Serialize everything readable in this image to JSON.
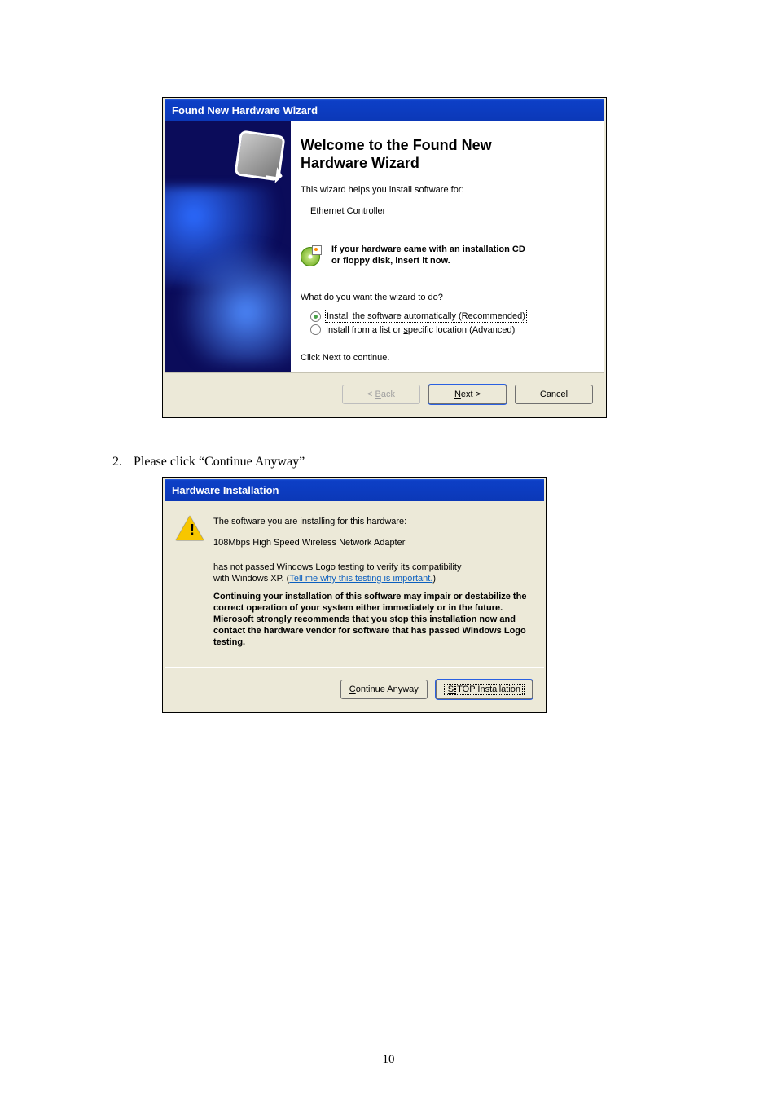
{
  "wizard1": {
    "title": "Found New Hardware Wizard",
    "heading_l1": "Welcome to the Found New",
    "heading_l2": "Hardware Wizard",
    "sub": "This wizard helps you install software for:",
    "device": "Ethernet Controller",
    "cd_l1": "If your hardware came with an installation CD",
    "cd_l2": "or floppy disk, insert it now.",
    "question": "What do you want the wizard to do?",
    "opt1": "Install the software automatically (Recommended)",
    "opt2_pre": "Install from a list or ",
    "opt2_u": "s",
    "opt2_post": "pecific location (Advanced)",
    "footer": "Click Next to continue.",
    "buttons": {
      "back_pre": "< ",
      "back_u": "B",
      "back_post": "ack",
      "next_u": "N",
      "next_post": "ext >",
      "cancel": "Cancel"
    }
  },
  "instruction": {
    "num": "2.",
    "text": "Please click “Continue Anyway”"
  },
  "wizard2": {
    "title": "Hardware Installation",
    "line1": "The software you are installing for this hardware:",
    "line2": "108Mbps High Speed Wireless Network Adapter",
    "line3a": "has not passed Windows Logo testing to verify its compatibility",
    "line3b_pre": "with Windows XP. (",
    "link": "Tell me why this testing is important.",
    "line3b_post": ")",
    "warn": "Continuing your installation of this software may impair or destabilize the correct operation of your system either immediately or in the future. Microsoft strongly recommends that you stop this installation now and contact the hardware vendor for software that has passed Windows Logo testing.",
    "buttons": {
      "continue_u": "C",
      "continue_post": "ontinue Anyway",
      "stop_u": "S",
      "stop_post": "TOP Installation"
    }
  },
  "page_number": "10"
}
